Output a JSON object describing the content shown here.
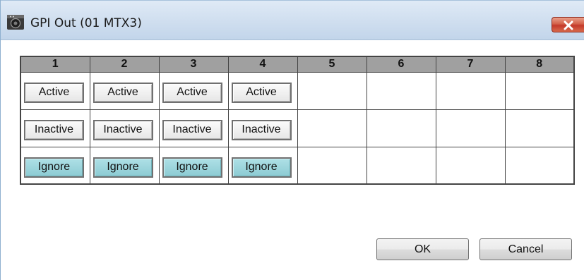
{
  "window": {
    "title": "GPI Out (01 MTX3)",
    "icon": "speaker-device-icon",
    "close_icon": "close-icon"
  },
  "grid": {
    "columns": [
      "1",
      "2",
      "3",
      "4",
      "5",
      "6",
      "7",
      "8"
    ],
    "rows": [
      {
        "state": "Active",
        "cells": [
          "Active",
          "Active",
          "Active",
          "Active",
          "",
          "",
          "",
          ""
        ]
      },
      {
        "state": "Inactive",
        "cells": [
          "Inactive",
          "Inactive",
          "Inactive",
          "Inactive",
          "",
          "",
          "",
          ""
        ]
      },
      {
        "state": "Ignore",
        "cells": [
          "Ignore",
          "Ignore",
          "Ignore",
          "Ignore",
          "",
          "",
          "",
          ""
        ]
      }
    ],
    "selected_state_per_channel": [
      "Ignore",
      "Ignore",
      "Ignore",
      "Ignore"
    ]
  },
  "buttons": {
    "ok": "OK",
    "cancel": "Cancel"
  },
  "colors": {
    "header_bg": "#a0a0a0",
    "selected_button_bg": "#9dd6dd",
    "close_button": "#c8432f"
  }
}
